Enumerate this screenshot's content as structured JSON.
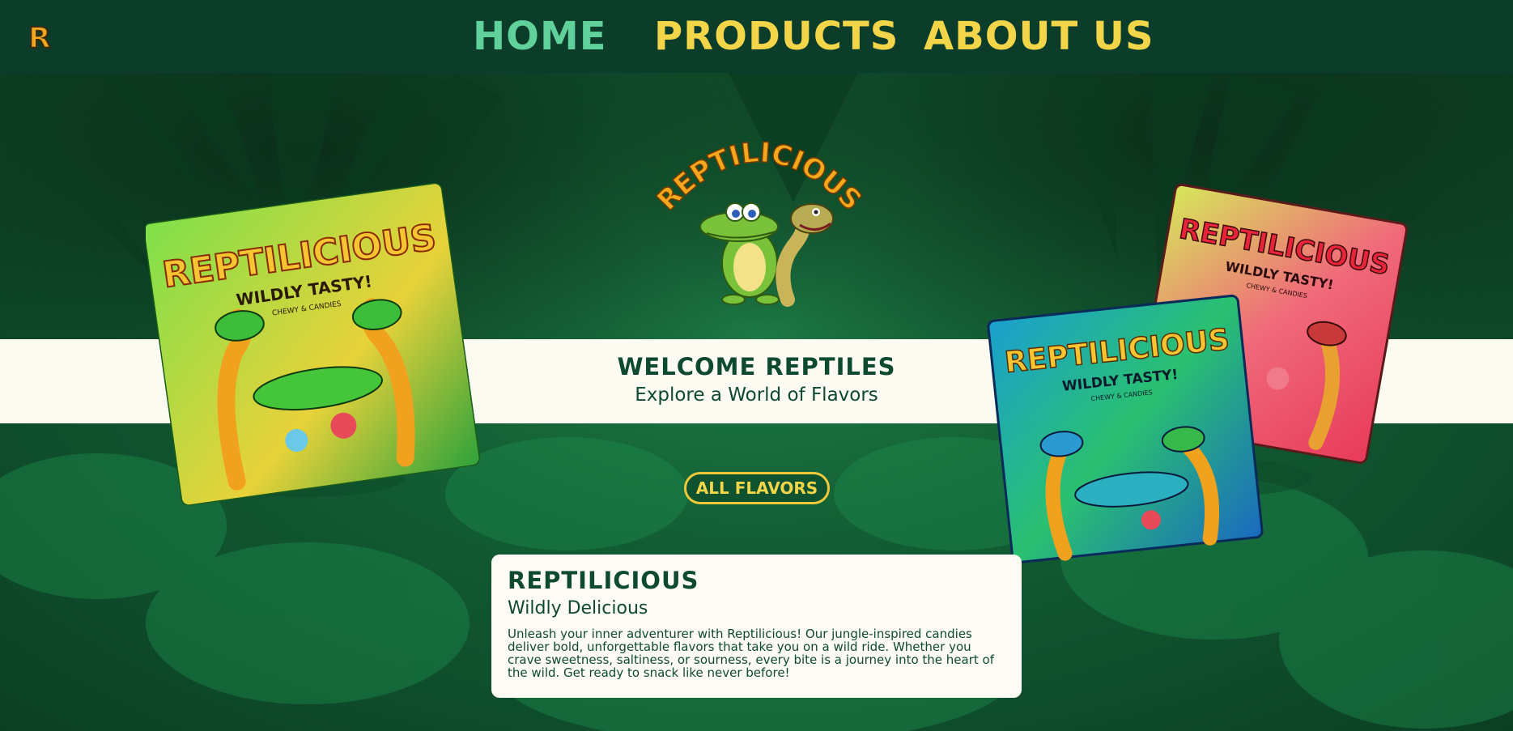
{
  "nav": {
    "logo_letter": "R",
    "items": [
      {
        "label": "HOME"
      },
      {
        "label": "PRODUCTS"
      },
      {
        "label": "ABOUT US"
      }
    ]
  },
  "hero": {
    "brand_logo_text": "REPTILICIOUS",
    "welcome_title": "WELCOME REPTILES",
    "welcome_subtitle": "Explore a World of Flavors",
    "cta_label": "ALL FLAVORS"
  },
  "packages": [
    {
      "brand": "REPTILICIOUS",
      "tagline": "WILDLY TASTY!",
      "small": "CHEWY & CANDIES",
      "theme": "green"
    },
    {
      "brand": "REPTILICIOUS",
      "tagline": "WILDLY TASTY!",
      "small": "CHEWY & CANDIES",
      "theme": "red"
    },
    {
      "brand": "REPTILICIOUS",
      "tagline": "WILDLY TASTY!",
      "small": "CHEWY & CANDIES",
      "theme": "blue"
    }
  ],
  "card": {
    "title": "REPTILICIOUS",
    "subtitle": "Wildly Delicious",
    "body": "Unleash your inner adventurer with Reptilicious! Our jungle-inspired candies deliver bold, unforgettable flavors that take you on a wild ride. Whether you crave sweetness, saltiness, or sourness, every bite is a journey into the heart of the wild. Get ready to snack like never before!"
  },
  "colors": {
    "nav_bg": "#0b3d2a",
    "nav_active": "#60d19a",
    "nav_text": "#f3d54a",
    "band_bg": "#fcfbf2",
    "text_dark": "#0d4a2e",
    "accent_yellow": "#f0c93a"
  }
}
